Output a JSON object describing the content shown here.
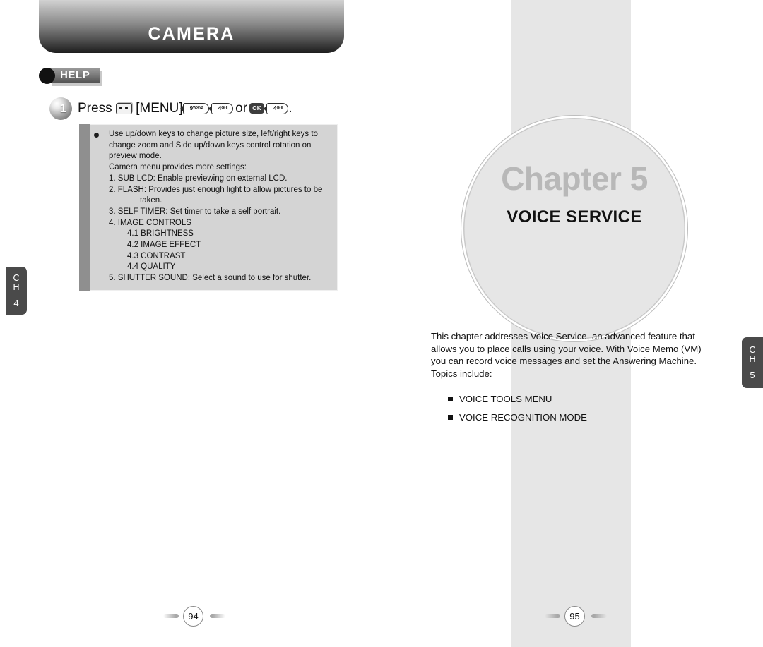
{
  "left_page": {
    "header_title": "CAMERA",
    "help_badge_label": "HELP",
    "step": {
      "number": "1",
      "verb": "Press",
      "menu_label": "[MENU]",
      "key_9": "9",
      "key_9_sub": "WXYZ",
      "key_4a": "4",
      "key_4a_sub": "GHI",
      "or": "or",
      "ok_label": "OK",
      "key_4b": "4",
      "key_4b_sub": "GHI",
      "period": "."
    },
    "help_box_lines": [
      {
        "text": "Use up/down keys to change picture size, left/right keys to",
        "indent": 0
      },
      {
        "text": "change zoom and Side up/down keys control rotation on",
        "indent": 0
      },
      {
        "text": "preview mode.",
        "indent": 0
      },
      {
        "text": "Camera menu provides more settings:",
        "indent": 0
      },
      {
        "text": "1. SUB LCD: Enable previewing on external LCD.",
        "indent": 0
      },
      {
        "text": "2. FLASH: Provides just enough light to allow pictures to be",
        "indent": 0
      },
      {
        "text": "taken.",
        "indent": 2
      },
      {
        "text": "3. SELF TIMER: Set timer to take a self portrait.",
        "indent": 0
      },
      {
        "text": "4. IMAGE CONTROLS",
        "indent": 0
      },
      {
        "text": "4.1 BRIGHTNESS",
        "indent": 1
      },
      {
        "text": "4.2 IMAGE EFFECT",
        "indent": 1
      },
      {
        "text": "4.3 CONTRAST",
        "indent": 1
      },
      {
        "text": "4.4 QUALITY",
        "indent": 1
      },
      {
        "text": "5. SHUTTER SOUND: Select a sound to use for shutter.",
        "indent": 0
      }
    ],
    "side_tab": {
      "line1": "C",
      "line2": "H",
      "number": "4"
    },
    "page_number": "94"
  },
  "right_page": {
    "chapter_word": "Chapter 5",
    "chapter_subtitle": "VOICE SERVICE",
    "intro_paragraph": "This chapter addresses Voice Service, an advanced feature that allows you to place calls using your voice. With Voice Memo (VM) you can record voice messages and set the Answering Machine. Topics include:",
    "topics": [
      "VOICE TOOLS MENU",
      "VOICE RECOGNITION MODE"
    ],
    "side_tab": {
      "line1": "C",
      "line2": "H",
      "number": "5"
    },
    "page_number": "95"
  },
  "colors": {
    "band_gray": "#e6e6e6",
    "tab_gray": "#4a4a4a",
    "help_box_gray": "#d4d4d4",
    "help_accent_gray": "#8f8f8f",
    "chapter_word_gray": "#b8b8b8"
  }
}
